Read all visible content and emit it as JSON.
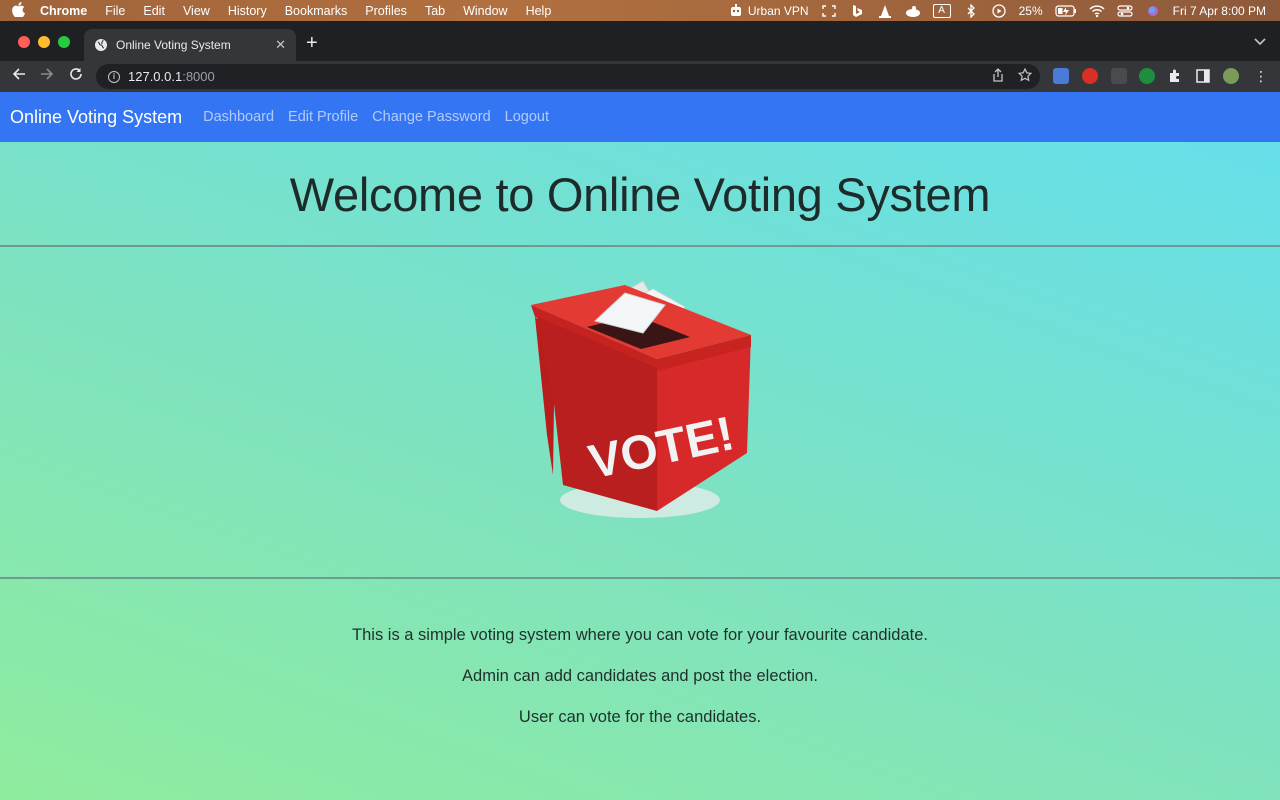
{
  "menubar": {
    "app": "Chrome",
    "items": [
      "File",
      "Edit",
      "View",
      "History",
      "Bookmarks",
      "Profiles",
      "Tab",
      "Window",
      "Help"
    ],
    "vpn_label": "Urban VPN",
    "input_indicator": "A",
    "battery": "25%",
    "datetime": "Fri 7 Apr  8:00 PM"
  },
  "browser": {
    "tab_title": "Online Voting System",
    "url_host": "127.0.0.1",
    "url_port": ":8000"
  },
  "site": {
    "brand": "Online Voting System",
    "nav": [
      "Dashboard",
      "Edit Profile",
      "Change Password",
      "Logout"
    ],
    "heading": "Welcome to Online Voting System",
    "box_text": "VOTE!",
    "lines": [
      "This is a simple voting system where you can vote for your favourite candidate.",
      "Admin can add candidates and post the election.",
      "User can vote for the candidates."
    ]
  },
  "colors": {
    "navbar": "#3375f3",
    "gradient_start": "#8fec9e",
    "gradient_end": "#63dfee",
    "ballot_red": "#d8292a"
  }
}
